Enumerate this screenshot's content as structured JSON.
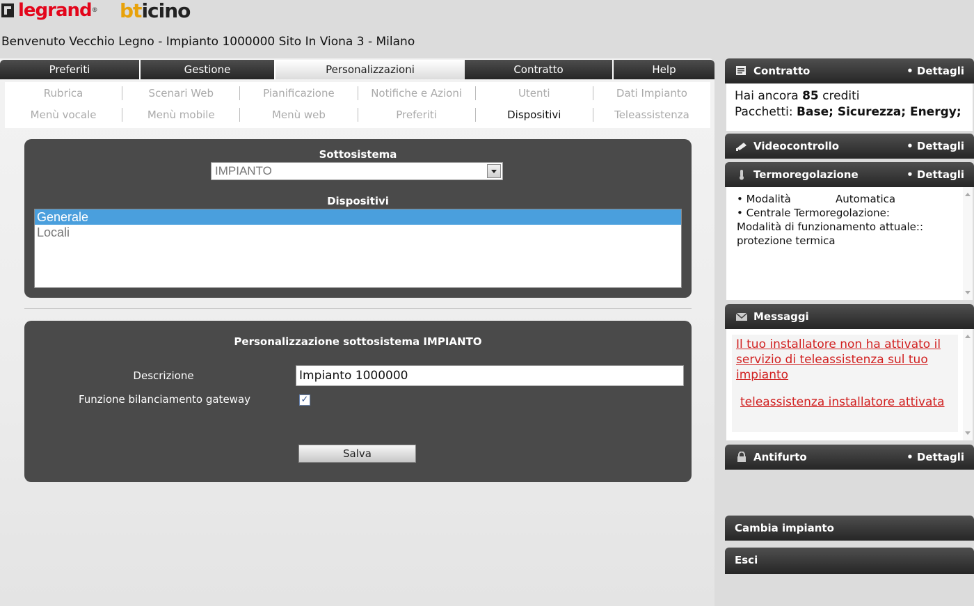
{
  "logos": {
    "legrand": "legrand",
    "legrand_mark": "®",
    "bticino_b": "bt",
    "bticino_rest": "icino"
  },
  "welcome": "Benvenuto Vecchio Legno - Impianto 1000000 Sito In Viona 3 - Milano",
  "main_tabs": [
    "Preferiti",
    "Gestione",
    "Personalizzazioni",
    "Contratto",
    "Help"
  ],
  "active_main_tab": "Personalizzazioni",
  "subnav": {
    "row1": [
      "Rubrica",
      "Scenari Web",
      "Pianificazione",
      "Notifiche e Azioni",
      "Utenti",
      "Dati Impianto"
    ],
    "row2": [
      "Menù vocale",
      "Menù mobile",
      "Menù web",
      "Preferiti",
      "Dispositivi",
      "Teleassistenza"
    ],
    "active": "Dispositivi"
  },
  "panel1": {
    "subsystem_label": "Sottosistema",
    "subsystem_value": "IMPIANTO",
    "devices_label": "Dispositivi",
    "devices": [
      "Generale",
      "Locali"
    ],
    "selected_device": "Generale"
  },
  "panel2": {
    "title": "Personalizzazione sottosistema IMPIANTO",
    "description_label": "Descrizione",
    "description_value": "Impianto 1000000",
    "gateway_label": "Funzione bilanciamento gateway",
    "gateway_checked": true,
    "check_glyph": "✓",
    "save_label": "Salva"
  },
  "sidebar": {
    "details_label": "• Dettagli",
    "contratto": {
      "title": "Contratto",
      "credits_prefix": "Hai ancora ",
      "credits_value": "85",
      "credits_suffix": " crediti",
      "packages_prefix": "Pacchetti: ",
      "packages": "Base; Sicurezza; Energy;"
    },
    "videocontrollo": {
      "title": "Videocontrollo"
    },
    "termoregolazione": {
      "title": "Termoregolazione",
      "line1_label": "• Modalità",
      "line1_value": "Automatica",
      "line2": "• Centrale Termoregolazione:",
      "line3": "Modalità di funzionamento attuale::",
      "line4": "protezione termica"
    },
    "messaggi": {
      "title": "Messaggi",
      "msg1": "Il tuo installatore non ha attivato il servizio di teleassistenza sul tuo impianto",
      "msg2": "teleassistenza installatore attivata"
    },
    "antifurto": {
      "title": "Antifurto"
    },
    "cambia_impianto": "Cambia impianto",
    "esci": "Esci"
  },
  "colors": {
    "accent": "#4a9fdd",
    "dark": "#4a4a4a",
    "link": "#d12020"
  },
  "icons": [
    "contract-icon",
    "video-icon",
    "thermometer-icon",
    "mail-icon",
    "lock-icon"
  ]
}
